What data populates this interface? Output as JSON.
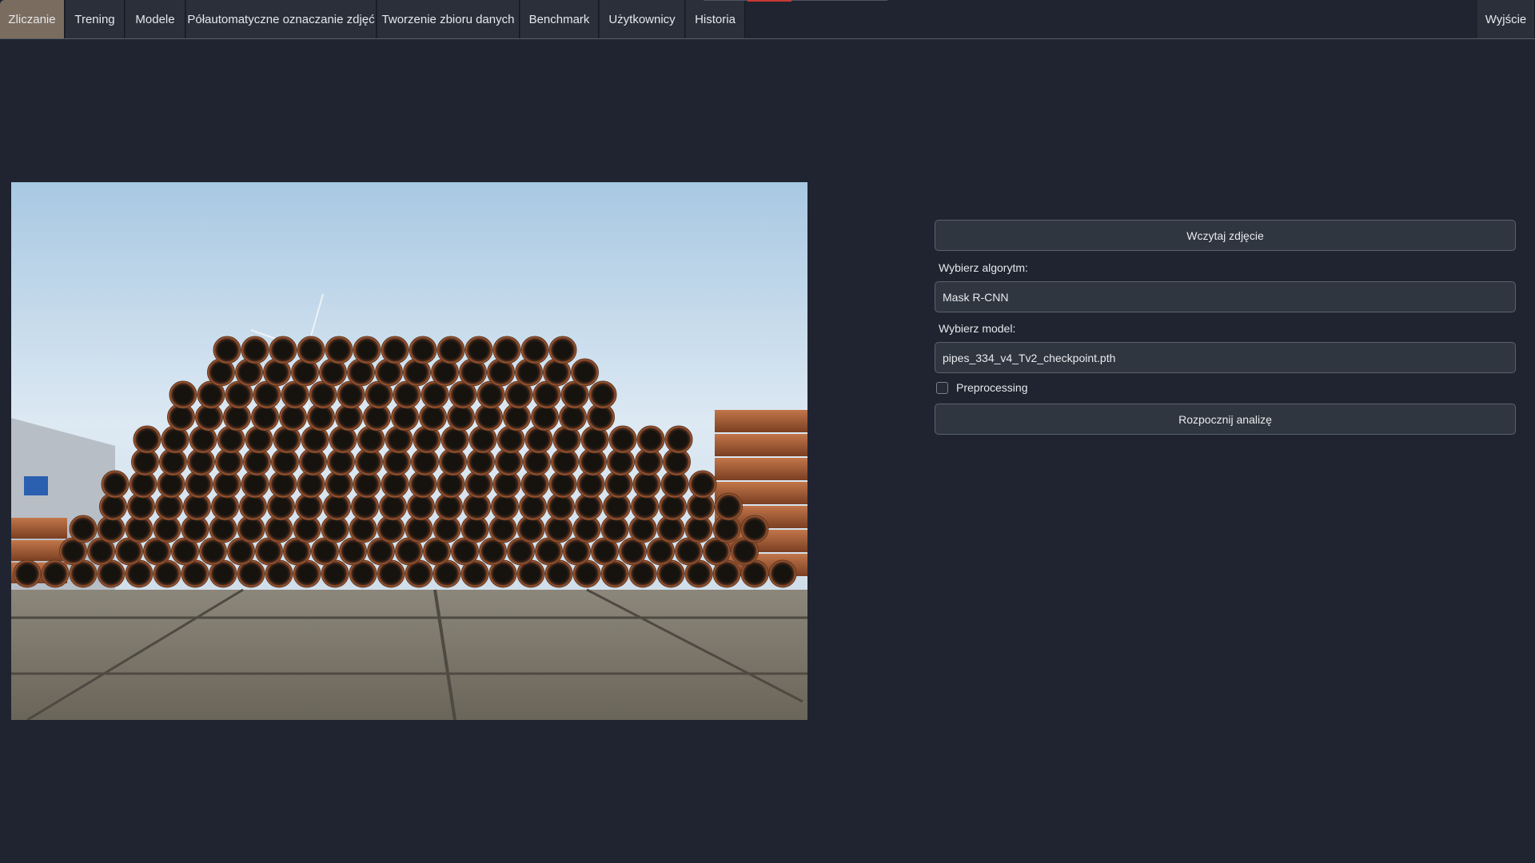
{
  "nav": {
    "tabs": [
      {
        "label": "Zliczanie",
        "active": true
      },
      {
        "label": "Trening"
      },
      {
        "label": "Modele"
      },
      {
        "label": "Półautomatyczne oznaczanie zdjęć"
      },
      {
        "label": "Tworzenie zbioru danych"
      },
      {
        "label": "Benchmark"
      },
      {
        "label": "Użytkownicy"
      },
      {
        "label": "Historia"
      }
    ],
    "exit_label": "Wyjście"
  },
  "panel": {
    "load_button": "Wczytaj zdjęcie",
    "algorithm_label": "Wybierz algorytm:",
    "algorithm_value": "Mask R-CNN",
    "model_label": "Wybierz model:",
    "model_value": "pipes_334_v4_Tv2_checkpoint.pth",
    "preprocessing_label": "Preprocessing",
    "preprocessing_checked": false,
    "start_button": "Rozpocznij analizę"
  },
  "colors": {
    "background": "#1f2430",
    "active_tab": "#7a6c5f",
    "accent_red": "#c93a35"
  }
}
